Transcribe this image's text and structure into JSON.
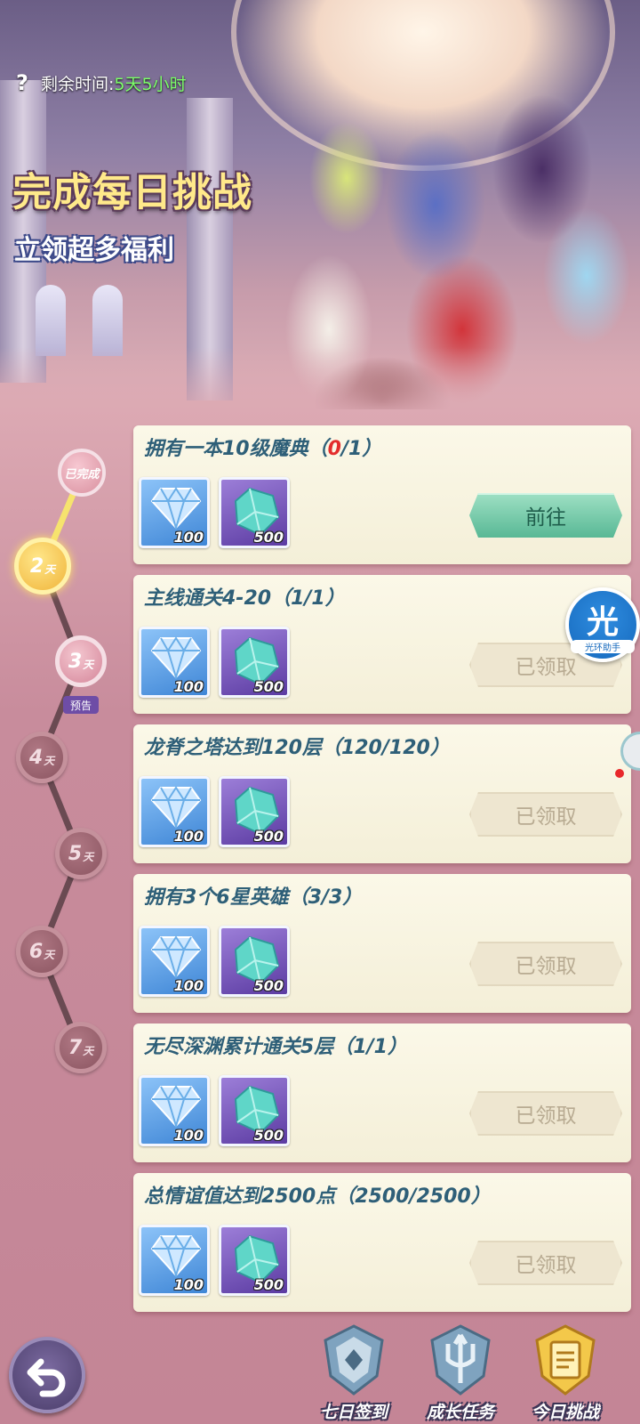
{
  "header": {
    "help_icon": "?",
    "remaining_label": "剩余时间:",
    "remaining_value": "5天5小时",
    "title": "完成每日挑战",
    "subtitle": "立领超多福利"
  },
  "timeline": {
    "completed_label": "已完成",
    "day_unit": "天",
    "preview_tag": "预告",
    "days": [
      {
        "num": "2",
        "state": "current"
      },
      {
        "num": "3",
        "state": "preview"
      },
      {
        "num": "4",
        "state": "locked"
      },
      {
        "num": "5",
        "state": "locked"
      },
      {
        "num": "6",
        "state": "locked"
      },
      {
        "num": "7",
        "state": "locked"
      }
    ]
  },
  "tasks": [
    {
      "title": "拥有一本10级魔典（",
      "current": "0",
      "total": "/1）",
      "rewards": [
        "100",
        "500"
      ],
      "button": "前往",
      "state": "go"
    },
    {
      "title": "主线通关4-20（",
      "current": "1",
      "total": "/1）",
      "rewards": [
        "100",
        "500"
      ],
      "button": "已领取",
      "state": "claimed"
    },
    {
      "title": "龙脊之塔达到120层（",
      "current": "120",
      "total": "/120）",
      "rewards": [
        "100",
        "500"
      ],
      "button": "已领取",
      "state": "claimed"
    },
    {
      "title": "拥有3个6星英雄（",
      "current": "3",
      "total": "/3）",
      "rewards": [
        "100",
        "500"
      ],
      "button": "已领取",
      "state": "claimed"
    },
    {
      "title": "无尽深渊累计通关5层（",
      "current": "1",
      "total": "/1）",
      "rewards": [
        "100",
        "500"
      ],
      "button": "已领取",
      "state": "claimed"
    },
    {
      "title": "总情谊值达到2500点（",
      "current": "2500",
      "total": "/2500）",
      "rewards": [
        "100",
        "500"
      ],
      "button": "已领取",
      "state": "claimed"
    }
  ],
  "helper": {
    "glyph": "光",
    "label": "光环助手"
  },
  "bottom_nav": [
    {
      "label": "七日签到",
      "icon": "shield-emblem-icon"
    },
    {
      "label": "成长任务",
      "icon": "trident-emblem-icon"
    },
    {
      "label": "今日挑战",
      "icon": "scroll-emblem-icon",
      "active": true
    }
  ],
  "colors": {
    "accent_gold": "#ffe98a",
    "timer_green": "#7dff6a",
    "progress_red": "#e32d2d",
    "go_button": "#58b895"
  }
}
